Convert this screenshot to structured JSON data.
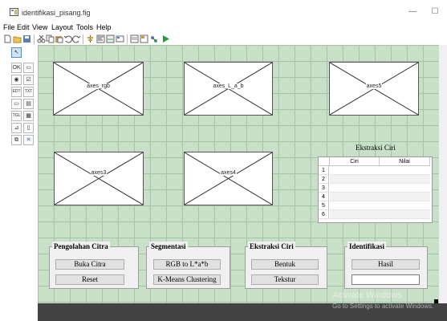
{
  "window": {
    "title": "identifikasi_pisang.fig",
    "minimize_glyph": "—",
    "maximize_glyph": "☐"
  },
  "menu": {
    "items": [
      "File",
      "Edit",
      "View",
      "Layout",
      "Tools",
      "Help"
    ]
  },
  "toolbar": {
    "icons": [
      "new-file-icon",
      "open-folder-icon",
      "save-icon",
      "cut-icon",
      "copy-icon",
      "paste-icon",
      "undo-icon",
      "redo-icon",
      "align-icon",
      "menu-editor-icon",
      "tab-order-icon",
      "toolbar-editor-icon",
      "editor-icon",
      "property-inspector-icon",
      "object-browser-icon",
      "run-icon"
    ],
    "run_color": "#1fa32b"
  },
  "palette": {
    "items": [
      {
        "name": "select-icon",
        "glyph": "↖"
      },
      {
        "name": "push-button-icon",
        "glyph": "OK"
      },
      {
        "name": "slider-icon",
        "glyph": "▭"
      },
      {
        "name": "radio-button-icon",
        "glyph": "◉"
      },
      {
        "name": "checkbox-icon",
        "glyph": "☑"
      },
      {
        "name": "edit-text-icon",
        "glyph": "EDT"
      },
      {
        "name": "static-text-icon",
        "glyph": "TXT"
      },
      {
        "name": "popup-menu-icon",
        "glyph": "▭"
      },
      {
        "name": "listbox-icon",
        "glyph": "▤"
      },
      {
        "name": "toggle-button-icon",
        "glyph": "TGL"
      },
      {
        "name": "table-icon",
        "glyph": "▦"
      },
      {
        "name": "axes-icon",
        "glyph": "⊿"
      },
      {
        "name": "panel-icon",
        "glyph": "▯"
      },
      {
        "name": "button-group-icon",
        "glyph": "⧉"
      },
      {
        "name": "activex-icon",
        "glyph": "✕"
      }
    ]
  },
  "axes": {
    "rgb": "axes_rgb",
    "lab": "axes_L_a_b",
    "a5": "axes5",
    "a3": "axes3",
    "a4": "axes4"
  },
  "feature_table": {
    "title": "Ekstraksi Ciri",
    "columns": [
      "Ciri",
      "Nilai"
    ],
    "rows": [
      "1",
      "2",
      "3",
      "4",
      "5",
      "6"
    ]
  },
  "panels": {
    "pengolahan": {
      "title": "Pengolahan Citra",
      "buttons": [
        "Buka Citra",
        "Reset"
      ]
    },
    "segmentasi": {
      "title": "Segmentasi",
      "buttons": [
        "RGB to L*a*b",
        "K-Means Clustering"
      ]
    },
    "ekstraksi": {
      "title": "Ekstraksi Ciri",
      "buttons": [
        "Bentuk",
        "Tekstur"
      ]
    },
    "identifikasi": {
      "title": "Identifikasi",
      "buttons": [
        "Hasil"
      ],
      "result_value": ""
    }
  },
  "watermark": {
    "line1": "Activate Windows",
    "line2": "Go to Settings to activate Windows."
  },
  "colors": {
    "canvas_bg": "#c7e0c7",
    "grid": "#a4c5a4",
    "bottom_bar": "#434343"
  }
}
